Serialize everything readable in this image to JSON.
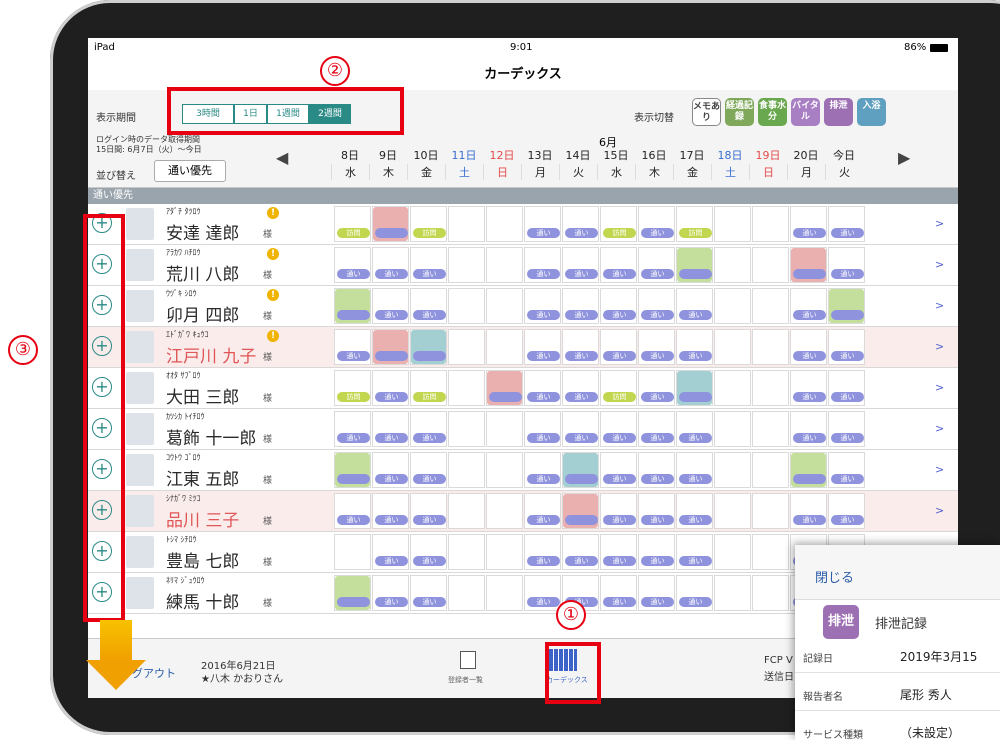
{
  "status": {
    "carrier": "iPad",
    "time": "9:01",
    "battery": "86%"
  },
  "title": "カーデックス",
  "toolbar": {
    "period_label": "表示期間",
    "periods": [
      {
        "label": "3時間",
        "active": false
      },
      {
        "label": "1日",
        "active": false
      },
      {
        "label": "1週間",
        "active": false
      },
      {
        "label": "2週間",
        "active": true
      }
    ],
    "display_switch_label": "表示切替",
    "display_buttons": [
      {
        "label": "メモあり",
        "color": "#ffffff",
        "fg": "#444444",
        "icon": "memo-icon"
      },
      {
        "label": "経過記録",
        "color": "#7fa85a",
        "fg": "#ffffff",
        "icon": "progress-record-icon"
      },
      {
        "label": "食事水分",
        "color": "#6aa84f",
        "fg": "#ffffff",
        "icon": "meal-icon"
      },
      {
        "label": "バイタル",
        "color": "#a97fc4",
        "fg": "#ffffff",
        "icon": "vital-icon"
      },
      {
        "label": "排泄",
        "color": "#9d6fb3",
        "fg": "#ffffff",
        "icon": "excretion-icon"
      },
      {
        "label": "入浴",
        "color": "#5f9fbf",
        "fg": "#ffffff",
        "icon": "bath-icon"
      }
    ],
    "login_info_1": "ログイン時のデータ取得期間",
    "login_info_2": "15日間: 6月7日（火）〜今日",
    "sort_label": "並び替え",
    "sort_value": "通い優先",
    "month": "6月",
    "dates": [
      {
        "day": "8日",
        "dow": "水",
        "color": "#222222"
      },
      {
        "day": "9日",
        "dow": "木",
        "color": "#222222"
      },
      {
        "day": "10日",
        "dow": "金",
        "color": "#222222"
      },
      {
        "day": "11日",
        "dow": "土",
        "color": "#3a6fd0"
      },
      {
        "day": "12日",
        "dow": "日",
        "color": "#e34b4b"
      },
      {
        "day": "13日",
        "dow": "月",
        "color": "#222222"
      },
      {
        "day": "14日",
        "dow": "火",
        "color": "#222222"
      },
      {
        "day": "15日",
        "dow": "水",
        "color": "#222222"
      },
      {
        "day": "16日",
        "dow": "木",
        "color": "#222222"
      },
      {
        "day": "17日",
        "dow": "金",
        "color": "#222222"
      },
      {
        "day": "18日",
        "dow": "土",
        "color": "#3a6fd0"
      },
      {
        "day": "19日",
        "dow": "日",
        "color": "#e34b4b"
      },
      {
        "day": "20日",
        "dow": "月",
        "color": "#222222"
      },
      {
        "day": "今日",
        "dow": "火",
        "color": "#222222"
      }
    ]
  },
  "group_label": "通い優先",
  "residents": [
    {
      "kana": "ｱﾀﾞﾁ ﾀﾂﾛｳ",
      "name": "安達 達郎",
      "sama": "様",
      "warn": true,
      "red": false,
      "cells": [
        "h",
        "r",
        "h",
        "",
        "",
        "t",
        "t",
        "h",
        "t",
        "h",
        "",
        "",
        "t",
        "t"
      ]
    },
    {
      "kana": "ｱﾗｶﾜ ﾊﾁﾛｳ",
      "name": "荒川 八郎",
      "sama": "様",
      "warn": true,
      "red": false,
      "cells": [
        "t",
        "t",
        "t",
        "",
        "",
        "t",
        "t",
        "t",
        "t",
        "g",
        "",
        "",
        "r",
        "t"
      ]
    },
    {
      "kana": "ｳﾂﾞｷ ｼﾛｳ",
      "name": "卯月 四郎",
      "sama": "様",
      "warn": true,
      "red": false,
      "cells": [
        "g",
        "t",
        "t",
        "",
        "",
        "t",
        "t",
        "t",
        "t",
        "t",
        "",
        "",
        "t",
        "g"
      ]
    },
    {
      "kana": "ｴﾄﾞｶﾞﾜ ｷｭｳｺ",
      "name": "江戸川 九子",
      "sama": "様",
      "warn": true,
      "red": true,
      "cells": [
        "t",
        "r",
        "b",
        "",
        "",
        "t",
        "t",
        "t",
        "t",
        "t",
        "",
        "",
        "t",
        "t"
      ]
    },
    {
      "kana": "ｵｵﾀ ｻﾌﾞﾛｳ",
      "name": "大田 三郎",
      "sama": "様",
      "warn": false,
      "red": false,
      "cells": [
        "h",
        "t",
        "h",
        "",
        "r",
        "t",
        "t",
        "h",
        "t",
        "b",
        "",
        "",
        "t",
        "t"
      ]
    },
    {
      "kana": "ｶﾂｼｶ ﾄｲﾁﾛｳ",
      "name": "葛飾 十一郎",
      "sama": "様",
      "warn": false,
      "red": false,
      "cells": [
        "t",
        "t",
        "t",
        "",
        "",
        "t",
        "t",
        "t",
        "t",
        "t",
        "",
        "",
        "t",
        "t"
      ]
    },
    {
      "kana": "ｺｳﾄｳ ｺﾞﾛｳ",
      "name": "江東 五郎",
      "sama": "様",
      "warn": false,
      "red": false,
      "cells": [
        "g",
        "t",
        "t",
        "",
        "",
        "t",
        "b",
        "t",
        "t",
        "t",
        "",
        "",
        "g",
        "t"
      ]
    },
    {
      "kana": "ｼﾅｶﾞﾜ ﾐﾂｺ",
      "name": "品川 三子",
      "sama": "様",
      "warn": false,
      "red": true,
      "cells": [
        "t",
        "t",
        "t",
        "",
        "",
        "t",
        "r",
        "t",
        "t",
        "t",
        "",
        "",
        "t",
        "t"
      ]
    },
    {
      "kana": "ﾄｼﾏ ｼﾁﾛｳ",
      "name": "豊島 七郎",
      "sama": "様",
      "warn": false,
      "red": false,
      "cells": [
        "",
        "t",
        "t",
        "",
        "",
        "t",
        "t",
        "t",
        "t",
        "t",
        "",
        "",
        "t",
        "t"
      ]
    },
    {
      "kana": "ﾈﾘﾏ ｼﾞｭｳﾛｳ",
      "name": "練馬 十郎",
      "sama": "様",
      "warn": false,
      "red": false,
      "cells": [
        "g",
        "t",
        "t",
        "",
        "",
        "t",
        "t",
        "t",
        "t",
        "t",
        "",
        "",
        "t",
        "t"
      ]
    }
  ],
  "pills": {
    "t": "通い",
    "h": "訪問"
  },
  "bottom": {
    "logout": "グアウト",
    "date": "2016年6月21日",
    "user": "★八木 かおりさん",
    "tab1": "登録者一覧",
    "tab2": "カーデックス",
    "fcp": "FCP V",
    "send": "送信日"
  },
  "popup": {
    "close": "閉じる",
    "badge": "排泄",
    "title": "排泄記録",
    "rows": [
      {
        "label": "記録日",
        "value": "2019年3月15"
      },
      {
        "label": "報告者名",
        "value": "尾形 秀人"
      },
      {
        "label": "サービス種類",
        "value": "（未設定）"
      }
    ]
  },
  "annotations": [
    "①",
    "②",
    "③"
  ]
}
